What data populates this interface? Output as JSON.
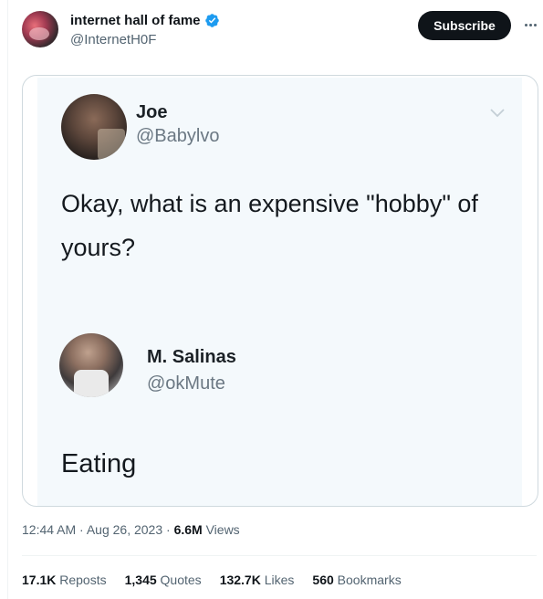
{
  "tweet": {
    "author": {
      "display_name": "internet hall of fame",
      "handle": "@InternetH0F",
      "verified_color": "#1d9bf0"
    },
    "subscribe_label": "Subscribe",
    "more_icon": "more-horizontal-icon"
  },
  "quoted_image": {
    "first_post": {
      "name": "Joe",
      "handle": "@Babylvo",
      "text_line1": "Okay, what is an expensive \"hobby\" of",
      "text_line2": "yours?"
    },
    "reply_post": {
      "name": "M. Salinas",
      "handle": "@okMute",
      "text": "Eating"
    }
  },
  "meta": {
    "time": "12:44 AM",
    "sep1": " · ",
    "date": "Aug 26, 2023",
    "sep2": " · ",
    "views_count": "6.6M",
    "views_label": " Views"
  },
  "stats": {
    "reposts_count": "17.1K",
    "reposts_label": " Reposts",
    "quotes_count": "1,345",
    "quotes_label": " Quotes",
    "likes_count": "132.7K",
    "likes_label": " Likes",
    "bookmarks_count": "560",
    "bookmarks_label": " Bookmarks"
  }
}
